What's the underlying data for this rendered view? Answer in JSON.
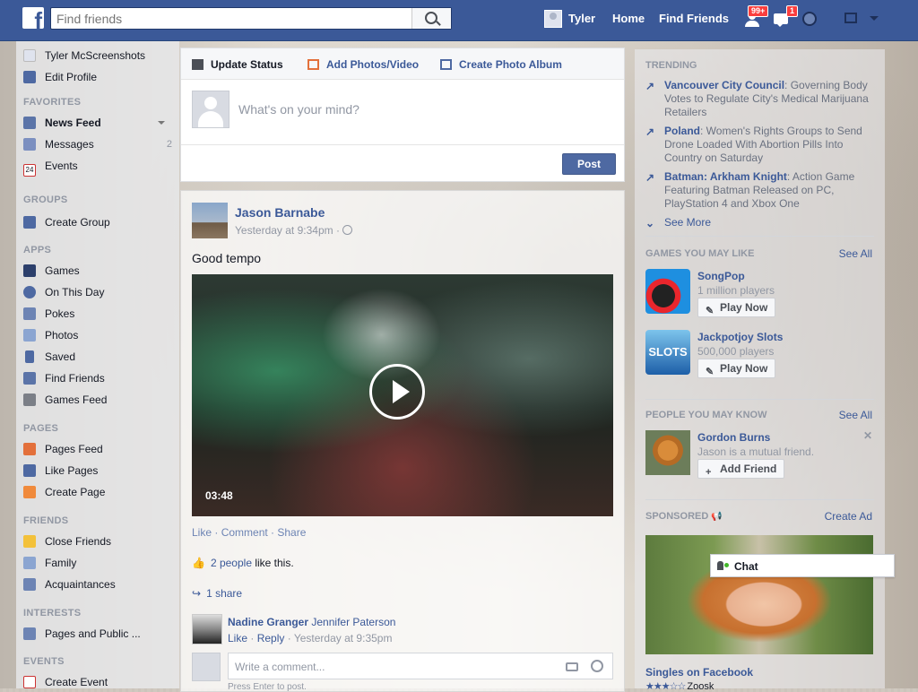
{
  "colors": {
    "brand": "#3b5998",
    "link": "#3b5998",
    "muted": "#9197a3",
    "badge": "#fa3e3e"
  },
  "topbar": {
    "search_placeholder": "Find friends",
    "user_name": "Tyler",
    "home_label": "Home",
    "find_friends_label": "Find Friends",
    "friend_requests_badge": "99+",
    "messages_badge": "1"
  },
  "left": {
    "profile_name": "Tyler McScreenshots",
    "edit_profile": "Edit Profile",
    "favorites_head": "FAVORITES",
    "news_feed": "News Feed",
    "messages": "Messages",
    "messages_count": "2",
    "events": "Events",
    "groups_head": "GROUPS",
    "create_group": "Create Group",
    "apps_head": "APPS",
    "games": "Games",
    "on_this_day": "On This Day",
    "pokes": "Pokes",
    "photos": "Photos",
    "saved": "Saved",
    "find_friends": "Find Friends",
    "games_feed": "Games Feed",
    "pages_head": "PAGES",
    "pages_feed": "Pages Feed",
    "like_pages": "Like Pages",
    "create_page": "Create Page",
    "friends_head": "FRIENDS",
    "close_friends": "Close Friends",
    "family": "Family",
    "acquaintances": "Acquaintances",
    "interests_head": "INTERESTS",
    "pages_public": "Pages and Public ...",
    "events_head": "EVENTS",
    "create_event": "Create Event"
  },
  "composer": {
    "tab_status": "Update Status",
    "tab_photos": "Add Photos/Video",
    "tab_album": "Create Photo Album",
    "placeholder": "What's on your mind?",
    "post_label": "Post"
  },
  "story": {
    "author": "Jason Barnabe",
    "time": "Yesterday at 9:34pm · ",
    "text": "Good tempo",
    "duration": "03:48",
    "like": "Like",
    "comment": "Comment",
    "share": "Share",
    "likes_link": "2 people",
    "likes_rest": " like this.",
    "shares": "1 share",
    "commenter": "Nadine Granger",
    "tagged": "Jennifer Paterson",
    "comment_like": "Like",
    "comment_reply": "Reply",
    "comment_time": "Yesterday at 9:35pm",
    "write_comment": "Write a comment...",
    "enter_hint": "Press Enter to post."
  },
  "right": {
    "trending_head": "TRENDING",
    "trends": [
      {
        "topic": "Vancouver City Council",
        "desc": ": Governing Body Votes to Regulate City's Medical Marijuana Retailers"
      },
      {
        "topic": "Poland",
        "desc": ": Women's Rights Groups to Send Drone Loaded With Abortion Pills Into Country on Saturday"
      },
      {
        "topic": "Batman: Arkham Knight",
        "desc": ": Action Game Featuring Batman Released on PC, PlayStation 4 and Xbox One"
      }
    ],
    "see_more": "See More",
    "games_head": "GAMES YOU MAY LIKE",
    "see_all": "See All",
    "games": [
      {
        "name": "SongPop",
        "players": "1 million players",
        "button": "Play Now"
      },
      {
        "name": "Jackpotjoy Slots",
        "players": "500,000 players",
        "button": "Play Now",
        "icon_text": "SLOTS"
      }
    ],
    "pymk_head": "PEOPLE YOU MAY KNOW",
    "person": {
      "name": "Gordon Burns",
      "sub": "Jason is a mutual friend.",
      "button": "Add Friend"
    },
    "sponsored_head": "SPONSORED",
    "create_ad": "Create Ad",
    "ad_title": "Singles on Facebook",
    "ad_sub": "Zoosk",
    "chat_label": "Chat"
  }
}
